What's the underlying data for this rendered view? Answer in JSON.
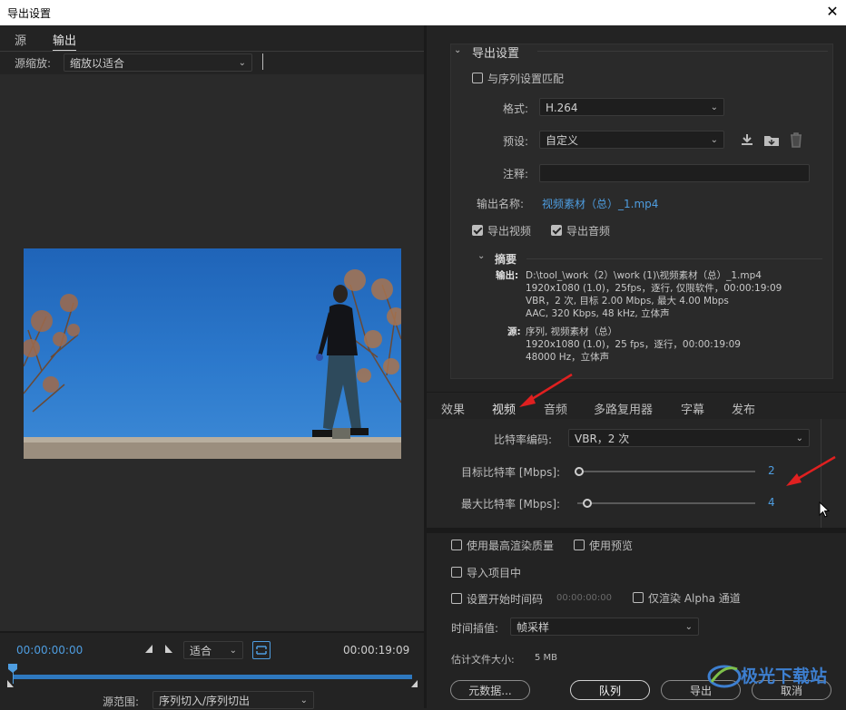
{
  "window": {
    "title": "导出设置",
    "close_glyph": "✕"
  },
  "left": {
    "tabs": [
      {
        "label": "源"
      },
      {
        "label": "输出"
      }
    ],
    "source_scale_label": "源缩放:",
    "source_scale_value": "缩放以适合",
    "timecode_start": "00:00:00:00",
    "fit_value": "适合",
    "timecode_end": "00:00:19:09",
    "source_range_label": "源范围:",
    "source_range_value": "序列切入/序列切出"
  },
  "export_settings": {
    "section_title": "导出设置",
    "match_sequence_label": "与序列设置匹配",
    "format_label": "格式:",
    "format_value": "H.264",
    "preset_label": "预设:",
    "preset_value": "自定义",
    "comments_label": "注释:",
    "comments_value": "",
    "output_name_label": "输出名称:",
    "output_name_value": "视频素材（总）_1.mp4",
    "export_video_label": "导出视频",
    "export_audio_label": "导出音频",
    "summary_title": "摘要",
    "summary_output_label": "输出:",
    "summary_output_lines": [
      "D:\\tool_\\work（2）\\work (1)\\视频素材（总）_1.mp4",
      "1920x1080 (1.0)，25fps，逐行, 仅限软件，00:00:19:09",
      "VBR，2 次, 目标 2.00 Mbps, 最大 4.00 Mbps",
      "AAC, 320 Kbps, 48  kHz, 立体声"
    ],
    "summary_source_label": "源:",
    "summary_source_lines": [
      "序列, 视频素材（总）",
      "1920x1080 (1.0)，25 fps，逐行，00:00:19:09",
      "48000 Hz，立体声"
    ]
  },
  "tabs": [
    {
      "label": "效果"
    },
    {
      "label": "视频"
    },
    {
      "label": "音频"
    },
    {
      "label": "多路复用器"
    },
    {
      "label": "字幕"
    },
    {
      "label": "发布"
    }
  ],
  "video": {
    "bitrate_encoding_label": "比特率编码:",
    "bitrate_encoding_value": "VBR，2 次",
    "target_bitrate_label": "目标比特率 [Mbps]:",
    "target_bitrate_value": "2",
    "max_bitrate_label": "最大比特率 [Mbps]:",
    "max_bitrate_value": "4"
  },
  "bottom": {
    "max_render_quality_label": "使用最高渲染质量",
    "use_previews_label": "使用预览",
    "import_into_project_label": "导入项目中",
    "set_start_timecode_label": "设置开始时间码",
    "start_timecode_value": "00:00:00:00",
    "render_alpha_label": "仅渲染 Alpha 通道",
    "time_interpolation_label": "时间插值:",
    "time_interpolation_value": "帧采样",
    "estimated_size_label": "估计文件大小:",
    "estimated_size_value": "5 MB",
    "metadata_button": "元数据...",
    "queue_button": "队列",
    "export_button": "导出",
    "cancel_button": "取消"
  },
  "watermark": "极光下载站",
  "colors": {
    "accent_blue": "#4e9de0",
    "arrow_red": "#e02020",
    "bg": "#232323",
    "panel": "#2b2b2b"
  }
}
